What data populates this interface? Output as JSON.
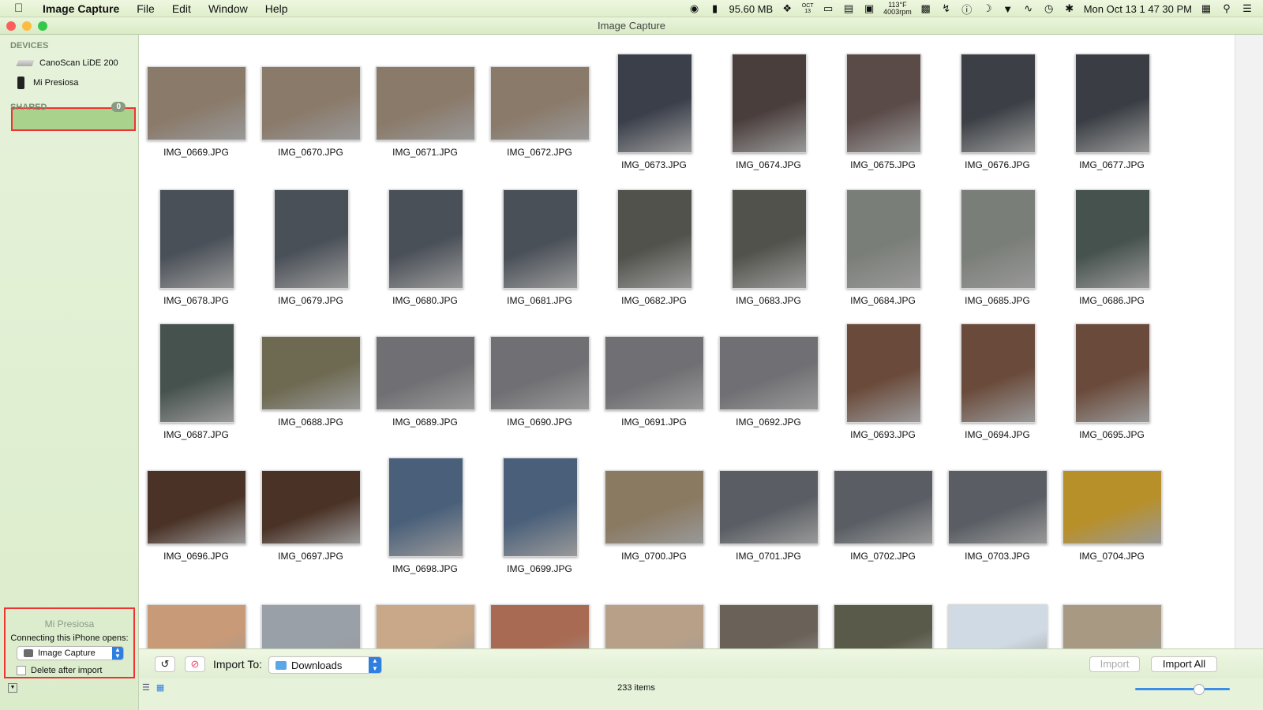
{
  "menubar": {
    "app": "Image Capture",
    "items": [
      "File",
      "Edit",
      "Window",
      "Help"
    ],
    "memory": "95.60 MB",
    "calendar_month": "OCT",
    "calendar_day": "13",
    "temp": "113°F",
    "rpm": "4003rpm",
    "clock": "Mon Oct 13  1 47 30 PM"
  },
  "window": {
    "title": "Image Capture"
  },
  "sidebar": {
    "devices_header": "DEVICES",
    "devices": [
      "CanoScan LiDE 200",
      "Mi Presiosa"
    ],
    "shared_header": "SHARED",
    "shared_count": "0",
    "device_panel": {
      "name": "Mi Presiosa",
      "label": "Connecting this iPhone opens:",
      "app_selected": "Image Capture",
      "delete_label": "Delete after import"
    }
  },
  "photos": [
    {
      "name": "IMG_0669.JPG",
      "color": "#8a7a6a"
    },
    {
      "name": "IMG_0670.JPG",
      "color": "#8a7a6a"
    },
    {
      "name": "IMG_0671.JPG",
      "color": "#8a7a6a"
    },
    {
      "name": "IMG_0672.JPG",
      "color": "#8a7a6a"
    },
    {
      "name": "IMG_0673.JPG",
      "color": "#3a3f4a"
    },
    {
      "name": "IMG_0674.JPG",
      "color": "#4a3e3c"
    },
    {
      "name": "IMG_0675.JPG",
      "color": "#5a4a48"
    },
    {
      "name": "IMG_0676.JPG",
      "color": "#3c4046"
    },
    {
      "name": "IMG_0677.JPG",
      "color": "#3a3e44"
    },
    {
      "name": "IMG_0678.JPG",
      "color": "#4a5058"
    },
    {
      "name": "IMG_0679.JPG",
      "color": "#4a5058"
    },
    {
      "name": "IMG_0680.JPG",
      "color": "#4a5058"
    },
    {
      "name": "IMG_0681.JPG",
      "color": "#4a5058"
    },
    {
      "name": "IMG_0682.JPG",
      "color": "#52524c"
    },
    {
      "name": "IMG_0683.JPG",
      "color": "#52524c"
    },
    {
      "name": "IMG_0684.JPG",
      "color": "#7a7e78"
    },
    {
      "name": "IMG_0685.JPG",
      "color": "#7a7e78"
    },
    {
      "name": "IMG_0686.JPG",
      "color": "#46524e"
    },
    {
      "name": "IMG_0687.JPG",
      "color": "#46524e"
    },
    {
      "name": "IMG_0688.JPG",
      "color": "#6e6a52"
    },
    {
      "name": "IMG_0689.JPG",
      "color": "#707074"
    },
    {
      "name": "IMG_0690.JPG",
      "color": "#707074"
    },
    {
      "name": "IMG_0691.JPG",
      "color": "#707074"
    },
    {
      "name": "IMG_0692.JPG",
      "color": "#707074"
    },
    {
      "name": "IMG_0693.JPG",
      "color": "#6a4a3a"
    },
    {
      "name": "IMG_0694.JPG",
      "color": "#6a4a3a"
    },
    {
      "name": "IMG_0695.JPG",
      "color": "#6a4a3a"
    },
    {
      "name": "IMG_0696.JPG",
      "color": "#4a3226"
    },
    {
      "name": "IMG_0697.JPG",
      "color": "#4a3226"
    },
    {
      "name": "IMG_0698.JPG",
      "color": "#4a607a"
    },
    {
      "name": "IMG_0699.JPG",
      "color": "#4a607a"
    },
    {
      "name": "IMG_0700.JPG",
      "color": "#8a7a62"
    },
    {
      "name": "IMG_0701.JPG",
      "color": "#5a5e64"
    },
    {
      "name": "IMG_0702.JPG",
      "color": "#5a5e64"
    },
    {
      "name": "IMG_0703.JPG",
      "color": "#5a5e64"
    },
    {
      "name": "IMG_0704.JPG",
      "color": "#b8902a"
    },
    {
      "name": "",
      "color": "#c89a78"
    },
    {
      "name": "",
      "color": "#9aa0a8"
    },
    {
      "name": "",
      "color": "#c8a888"
    },
    {
      "name": "",
      "color": "#a86a52"
    },
    {
      "name": "",
      "color": "#b8a088"
    },
    {
      "name": "",
      "color": "#6a6258"
    },
    {
      "name": "",
      "color": "#5a5a4a"
    },
    {
      "name": "",
      "color": "#d0dae4"
    },
    {
      "name": "",
      "color": "#a89a82"
    }
  ],
  "toolbar": {
    "import_to_label": "Import To:",
    "destination": "Downloads",
    "import_label": "Import",
    "import_all_label": "Import All"
  },
  "status": {
    "count": "233 items"
  }
}
